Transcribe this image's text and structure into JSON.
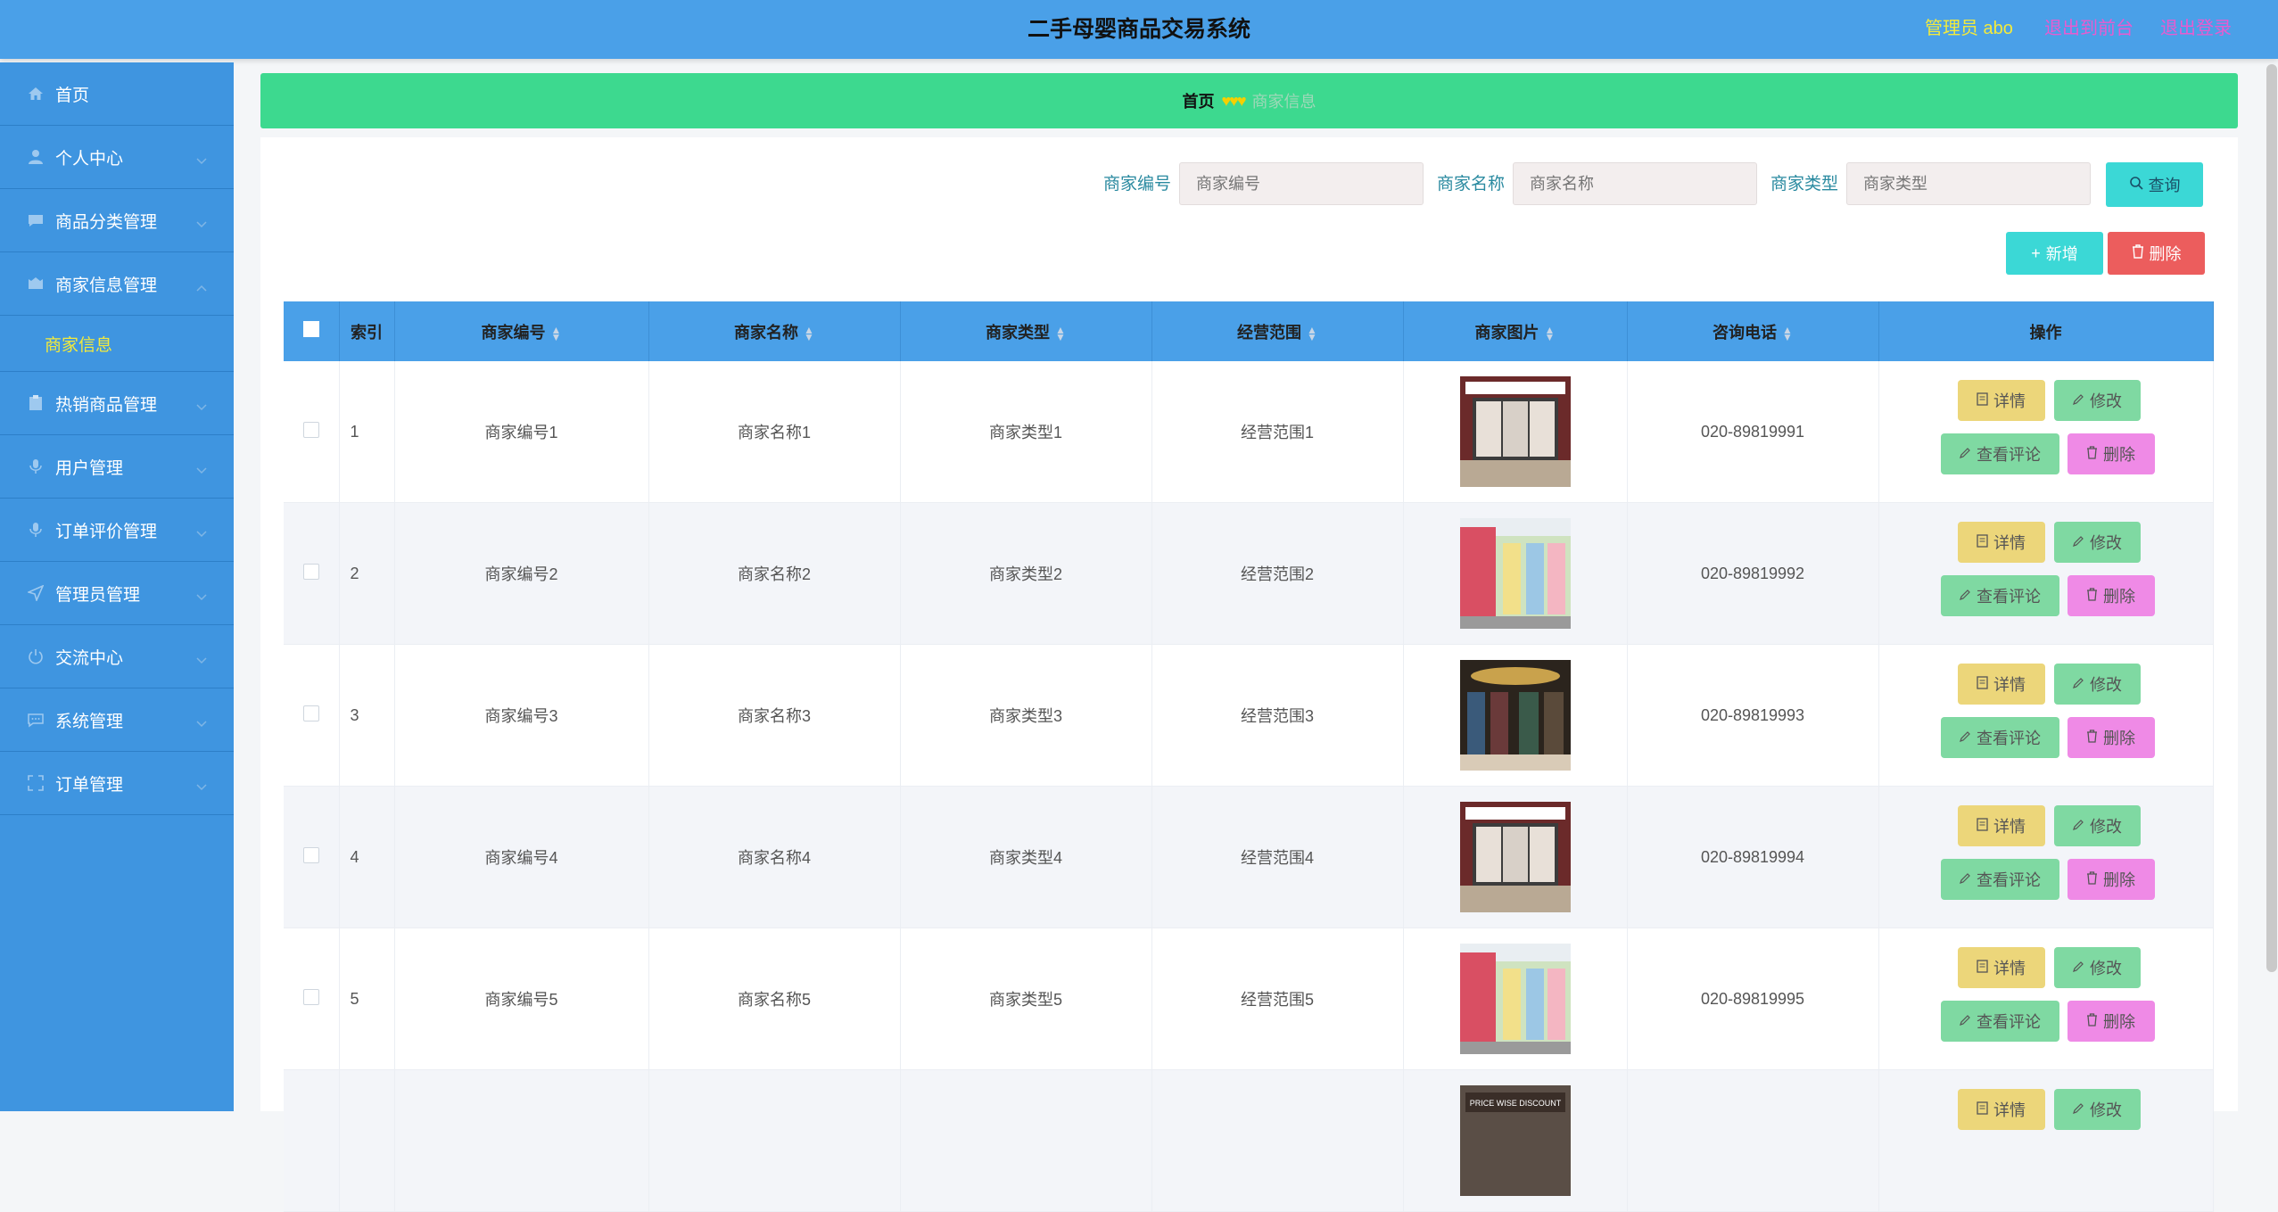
{
  "header": {
    "title": "二手母婴商品交易系统",
    "admin": "管理员 abo",
    "to_front": "退出到前台",
    "logout": "退出登录"
  },
  "sidebar": {
    "items": [
      {
        "label": "首页",
        "icon": "home-icon"
      },
      {
        "label": "个人中心",
        "icon": "user-icon"
      },
      {
        "label": "商品分类管理",
        "icon": "chat-icon"
      },
      {
        "label": "商家信息管理",
        "icon": "shop-icon",
        "expanded": true,
        "sub": "商家信息"
      },
      {
        "label": "热销商品管理",
        "icon": "clipboard-icon"
      },
      {
        "label": "用户管理",
        "icon": "mic-icon"
      },
      {
        "label": "订单评价管理",
        "icon": "mic-icon"
      },
      {
        "label": "管理员管理",
        "icon": "send-icon"
      },
      {
        "label": "交流中心",
        "icon": "power-icon"
      },
      {
        "label": "系统管理",
        "icon": "message-icon"
      },
      {
        "label": "订单管理",
        "icon": "fullscreen-icon"
      }
    ]
  },
  "breadcrumb": {
    "home": "首页",
    "current": "商家信息"
  },
  "search": {
    "field1_label": "商家编号",
    "field1_placeholder": "商家编号",
    "field2_label": "商家名称",
    "field2_placeholder": "商家名称",
    "field3_label": "商家类型",
    "field3_placeholder": "商家类型",
    "query": "查询"
  },
  "actions": {
    "add": "新增",
    "delete": "删除"
  },
  "table": {
    "headers": {
      "index": "索引",
      "code": "商家编号",
      "name": "商家名称",
      "type": "商家类型",
      "scope": "经营范围",
      "image": "商家图片",
      "phone": "咨询电话",
      "ops": "操作"
    },
    "op_labels": {
      "detail": "详情",
      "edit": "修改",
      "review": "查看评论",
      "delete": "删除"
    },
    "rows": [
      {
        "index": "1",
        "code": "商家编号1",
        "name": "商家名称1",
        "type": "商家类型1",
        "scope": "经营范围1",
        "phone": "020-89819991"
      },
      {
        "index": "2",
        "code": "商家编号2",
        "name": "商家名称2",
        "type": "商家类型2",
        "scope": "经营范围2",
        "phone": "020-89819992"
      },
      {
        "index": "3",
        "code": "商家编号3",
        "name": "商家名称3",
        "type": "商家类型3",
        "scope": "经营范围3",
        "phone": "020-89819993"
      },
      {
        "index": "4",
        "code": "商家编号4",
        "name": "商家名称4",
        "type": "商家类型4",
        "scope": "经营范围4",
        "phone": "020-89819994"
      },
      {
        "index": "5",
        "code": "商家编号5",
        "name": "商家名称5",
        "type": "商家类型5",
        "scope": "经营范围5",
        "phone": "020-89819995"
      },
      {
        "index": "",
        "code": "",
        "name": "",
        "type": "",
        "scope": "",
        "phone": ""
      }
    ]
  },
  "photo_6_caption": "PRICE WISE DISCOUNT",
  "colors": {
    "header_bg": "#4aa0e8",
    "sidebar_bg": "#3f95e0",
    "breadcrumb_bg": "#3dd98f",
    "accent_yellow": "#f3ea3c",
    "accent_pink": "#e85bd0"
  }
}
